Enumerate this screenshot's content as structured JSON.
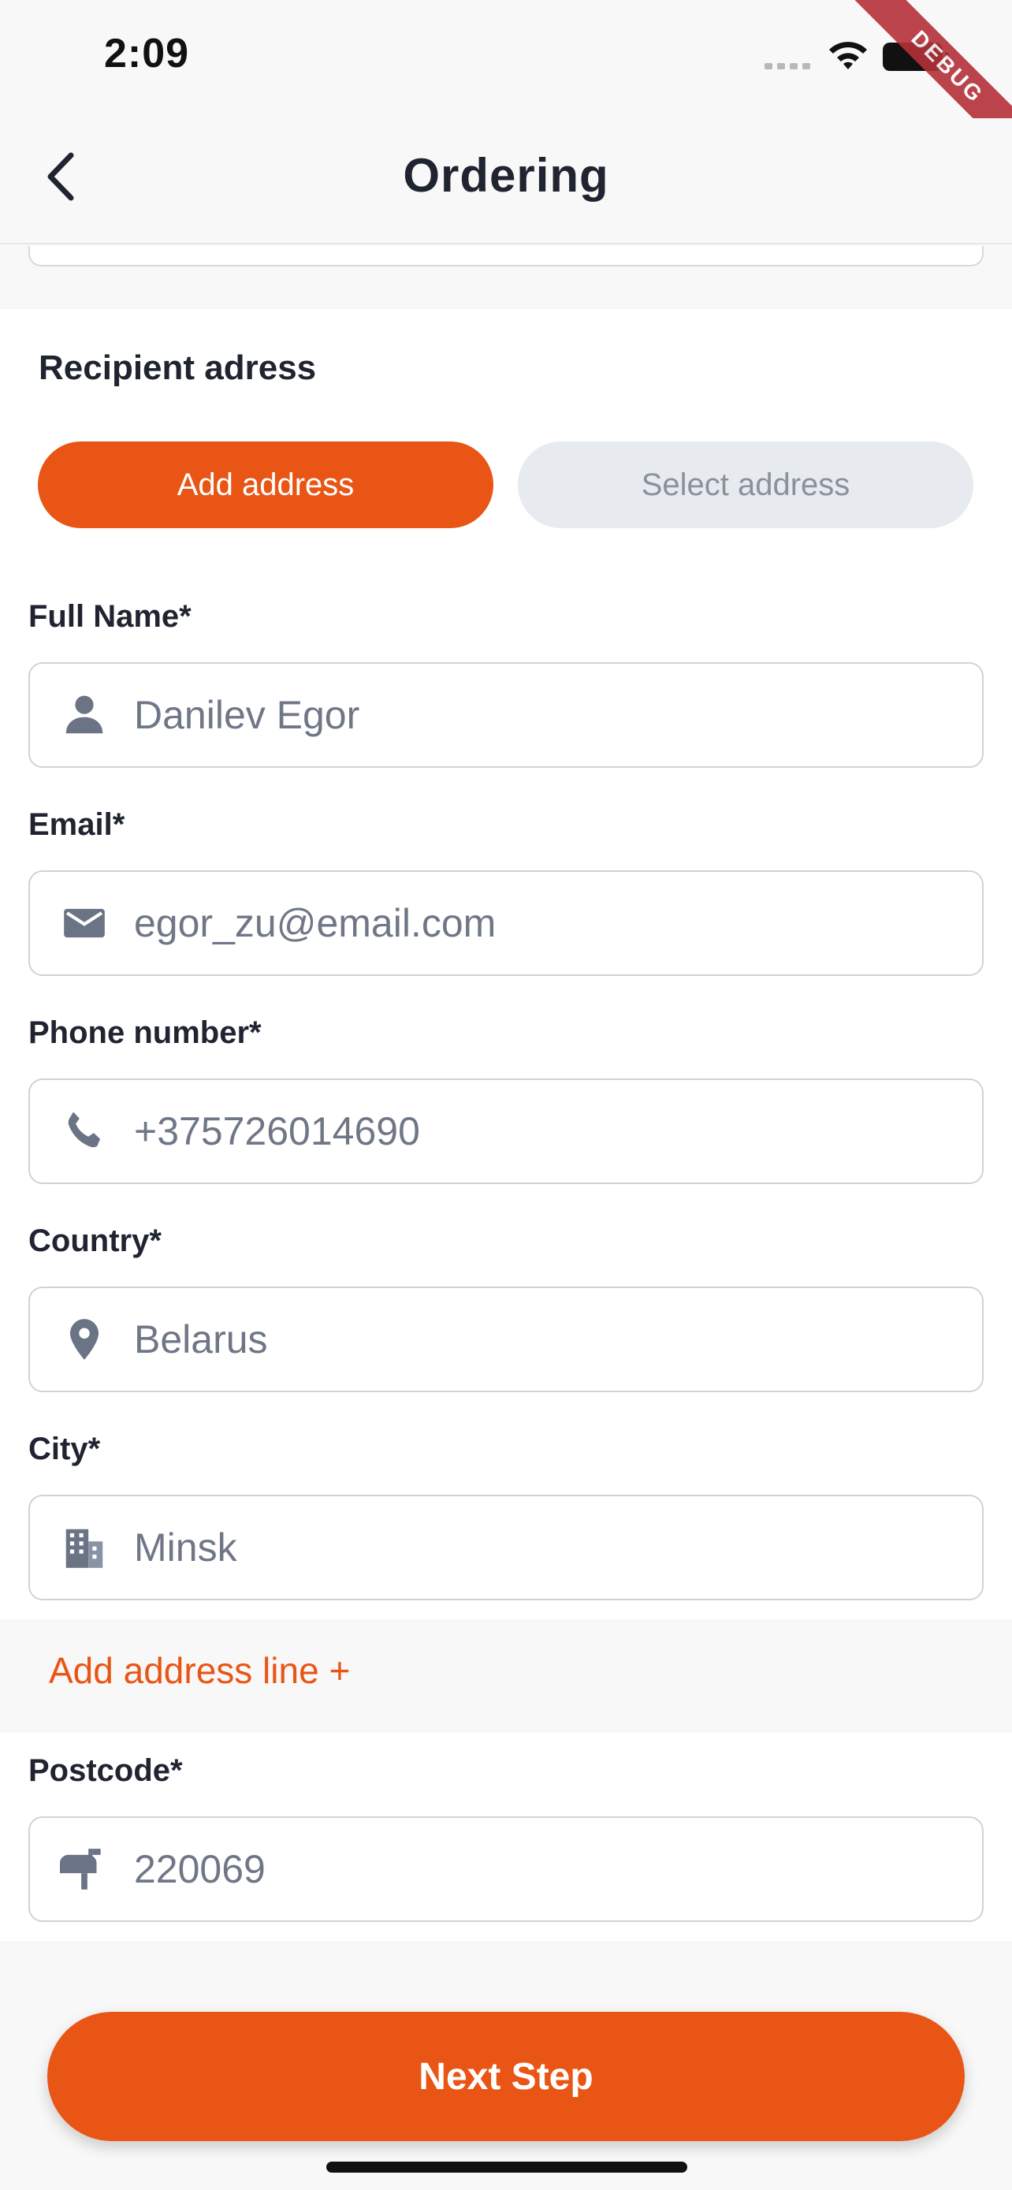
{
  "status_bar": {
    "time": "2:09"
  },
  "debug_ribbon": "DEBUG",
  "header": {
    "title": "Ordering"
  },
  "section": {
    "title": "Recipient adress"
  },
  "address_mode": {
    "add_label": "Add address",
    "select_label": "Select address",
    "selected": "Add address"
  },
  "fields": {
    "full_name": {
      "label": "Full Name*",
      "value": "Danilev Egor",
      "icon": "person-icon"
    },
    "email": {
      "label": "Email*",
      "value": "egor_zu@email.com",
      "icon": "mail-icon"
    },
    "phone": {
      "label": "Phone number*",
      "value": "+375726014690",
      "icon": "phone-icon"
    },
    "country": {
      "label": "Country*",
      "value": "Belarus",
      "icon": "location-pin-icon"
    },
    "city": {
      "label": "City*",
      "value": "Minsk",
      "icon": "building-icon"
    },
    "postcode": {
      "label": "Postcode*",
      "value": "220069",
      "icon": "mailbox-icon"
    }
  },
  "add_address_line": "Add address line +",
  "footer": {
    "next_label": "Next Step"
  },
  "colors": {
    "accent": "#e95514",
    "muted_button": "#e7eaee",
    "icon": "#6b7485"
  }
}
